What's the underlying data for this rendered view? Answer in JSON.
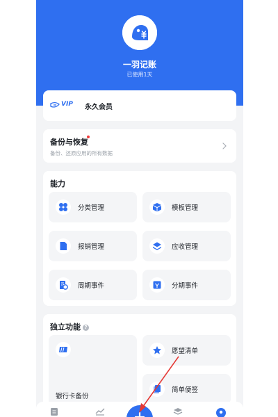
{
  "header": {
    "app_name": "一羽记账",
    "usage": "已使用1天",
    "accent_color": "#2f6ff0",
    "logo_icon": "bird-yen-icon"
  },
  "membership": {
    "badge_text": "VIP",
    "label": "永久会员"
  },
  "backup": {
    "title": "备份与恢复",
    "description": "备份、还原应用的所有数据",
    "has_notification_dot": true
  },
  "abilities": {
    "title": "能力",
    "items": [
      {
        "label": "分类管理",
        "icon": "grid-icon"
      },
      {
        "label": "模板管理",
        "icon": "cube-icon"
      },
      {
        "label": "报销管理",
        "icon": "document-icon"
      },
      {
        "label": "应收管理",
        "icon": "layers-icon"
      },
      {
        "label": "周期事件",
        "icon": "calendar-cycle-icon"
      },
      {
        "label": "分期事件",
        "icon": "installment-icon"
      }
    ]
  },
  "independent": {
    "title": "独立功能",
    "bank_card_backup": "银行卡备份",
    "wishlist": "愿望清单",
    "notes": "简单便签"
  },
  "tabbar": {
    "items": [
      "list-icon",
      "chart-icon",
      "add-icon",
      "layers-icon",
      "profile-icon"
    ],
    "active": "profile-icon"
  }
}
